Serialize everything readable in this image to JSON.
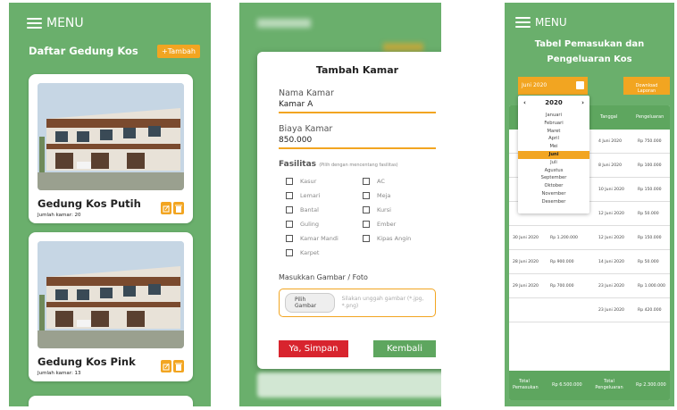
{
  "colors": {
    "green": "#6aaf6c",
    "header_green": "#5ea65f",
    "accent": "#f2a521",
    "danger": "#d8242e"
  },
  "screen1": {
    "menu_label": "MENU",
    "title": "Daftar Gedung Kos",
    "add_button": "+Tambah",
    "cards": [
      {
        "name": "Gedung Kos Putih",
        "rooms": "Jumlah kamar: 20"
      },
      {
        "name": "Gedung Kos Pink",
        "rooms": "Jumlah kamar: 13"
      }
    ]
  },
  "screen2": {
    "title": "Tambah Kamar",
    "name_label": "Nama Kamar",
    "name_value": "Kamar A",
    "cost_label": "Biaya Kamar",
    "cost_value": "850.000",
    "facilities_label": "Fasilitas",
    "facilities_hint": "(Pilih dengan mencentang fasilitas)",
    "facilities_left": [
      "Kasur",
      "Lemari",
      "Bantal",
      "Guling",
      "Kamar Mandi",
      "Karpet"
    ],
    "facilities_right": [
      "AC",
      "Meja",
      "Kursi",
      "Ember",
      "Kipas Angin"
    ],
    "upload_label": "Masukkan Gambar / Foto",
    "upload_button": "Pilih Gambar",
    "upload_hint": "Silakan unggah gambar (*.jpg, *.png)",
    "save_button": "Ya, Simpan",
    "back_button": "Kembali"
  },
  "screen3": {
    "menu_label": "MENU",
    "title_line1": "Tabel Pemasukan dan",
    "title_line2": "Pengeluaran Kos",
    "month_value": "Juni 2020",
    "download_button": "Download Laporan",
    "picker_year": "2020",
    "months": [
      "Januari",
      "Februari",
      "Maret",
      "April",
      "Mei",
      "Juni",
      "Juli",
      "Agustus",
      "September",
      "Oktober",
      "November",
      "Desember"
    ],
    "selected_month_index": 5,
    "headers": {
      "tanggal": "Tanggal",
      "pengeluaran": "Pengeluaran"
    },
    "rows": [
      {
        "t1": "",
        "p1": "",
        "t2": "4 Juni 2020",
        "p2": "Rp 750.000"
      },
      {
        "t1": "",
        "p1": "",
        "t2": "8 Juni 2020",
        "p2": "Rp 100.000"
      },
      {
        "t1": "",
        "p1": "",
        "t2": "10 Juni 2020",
        "p2": "Rp 150.000"
      },
      {
        "t1": "",
        "p1": "",
        "t2": "12 Juni 2020",
        "p2": "Rp 50.000"
      },
      {
        "t1": "30 Juni 2020",
        "p1": "Rp 1.200.000",
        "t2": "12 Juni 2020",
        "p2": "Rp 150.000"
      },
      {
        "t1": "28 Juni 2020",
        "p1": "Rp 900.000",
        "t2": "14 Juni 2020",
        "p2": "Rp 50.000"
      },
      {
        "t1": "29 Juni 2020",
        "p1": "Rp 700.000",
        "t2": "23 Juni 2020",
        "p2": "Rp 1.000.000"
      },
      {
        "t1": "",
        "p1": "",
        "t2": "23 Juni 2020",
        "p2": "Rp 420.000"
      }
    ],
    "footer": {
      "income_label": "Total Pemasukan",
      "income_value": "Rp 6.500.000",
      "expense_label": "Total Pengeluaran",
      "expense_value": "Rp 2.300.000"
    }
  }
}
